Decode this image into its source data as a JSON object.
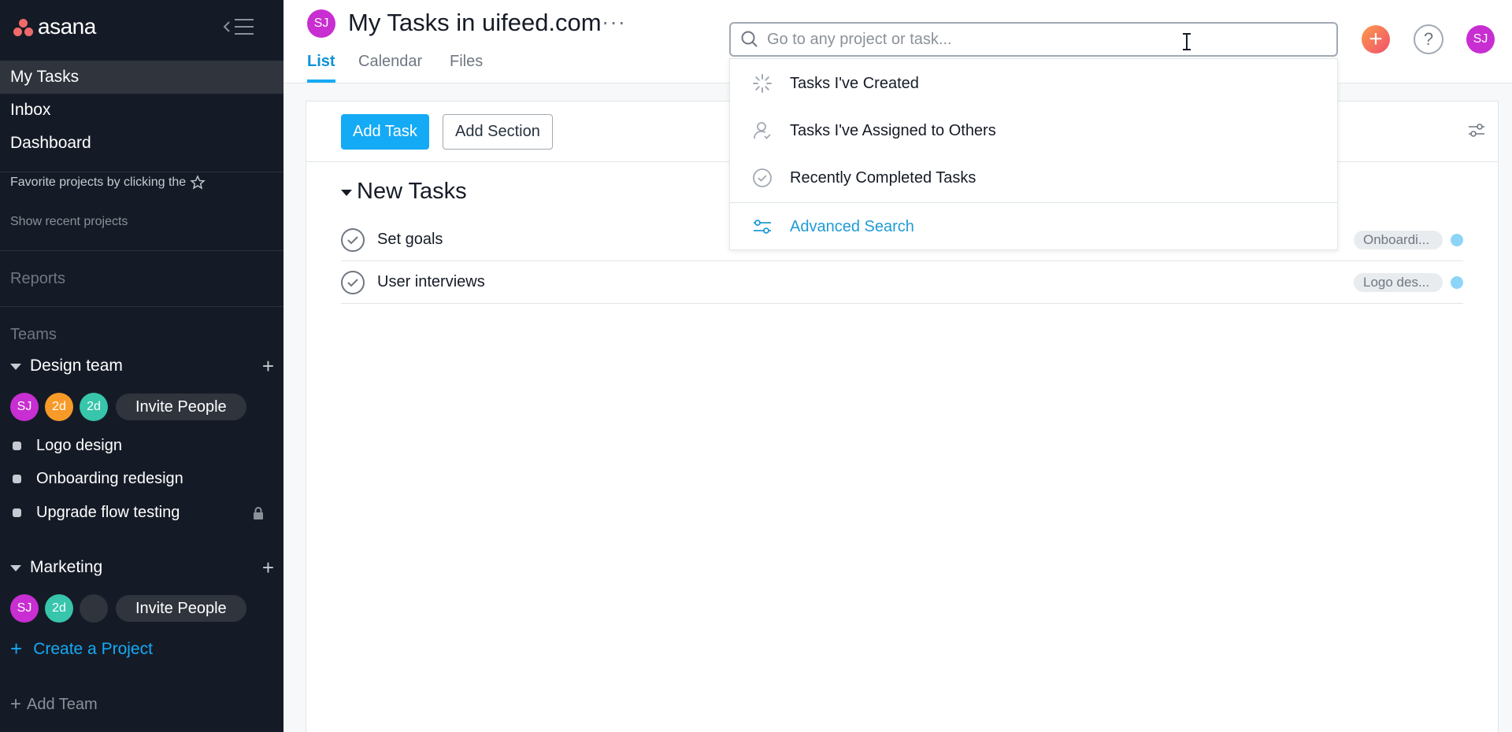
{
  "sidebar": {
    "logo_text": "asana",
    "nav": [
      {
        "label": "My Tasks",
        "active": true
      },
      {
        "label": "Inbox",
        "active": false
      },
      {
        "label": "Dashboard",
        "active": false
      }
    ],
    "favorites_hint": "Favorite projects by clicking the",
    "show_recent": "Show recent projects",
    "reports_label": "Reports",
    "teams_label": "Teams",
    "teams": [
      {
        "name": "Design team",
        "members": [
          {
            "initials": "SJ",
            "color": "#c82ed1"
          },
          {
            "initials": "2d",
            "color": "#f79a28"
          },
          {
            "initials": "2d",
            "color": "#37c5ab"
          }
        ],
        "invite_label": "Invite People",
        "projects": [
          {
            "name": "Logo design",
            "locked": false
          },
          {
            "name": "Onboarding redesign",
            "locked": false
          },
          {
            "name": "Upgrade flow testing",
            "locked": true
          }
        ]
      },
      {
        "name": "Marketing",
        "members": [
          {
            "initials": "SJ",
            "color": "#c82ed1"
          },
          {
            "initials": "2d",
            "color": "#37c5ab"
          },
          {
            "initials": "",
            "color": "#2f343d"
          }
        ],
        "invite_label": "Invite People",
        "projects": []
      }
    ],
    "create_project": "Create a Project",
    "add_team": "Add Team"
  },
  "header": {
    "avatar_initials": "SJ",
    "title": "My Tasks in uifeed.com",
    "more": "···",
    "tabs": [
      {
        "label": "List",
        "active": true
      },
      {
        "label": "Calendar",
        "active": false
      },
      {
        "label": "Files",
        "active": false
      }
    ],
    "search_placeholder": "Go to any project or task...",
    "help_label": "?",
    "user_initials": "SJ"
  },
  "toolbar": {
    "add_task": "Add Task",
    "add_section": "Add Section"
  },
  "section": {
    "title": "New Tasks",
    "tasks": [
      {
        "name": "Set goals",
        "tag": "Onboardi...",
        "dot_color": "#8dd5f8"
      },
      {
        "name": "User interviews",
        "tag": "Logo des...",
        "dot_color": "#8dd5f8"
      }
    ]
  },
  "search_dropdown": {
    "items": [
      {
        "label": "Tasks I've Created",
        "icon": "spinner-icon"
      },
      {
        "label": "Tasks I've Assigned to Others",
        "icon": "person-check-icon"
      },
      {
        "label": "Recently Completed Tasks",
        "icon": "check-circle-icon"
      }
    ],
    "advanced": {
      "label": "Advanced Search",
      "icon": "sliders-icon"
    }
  }
}
